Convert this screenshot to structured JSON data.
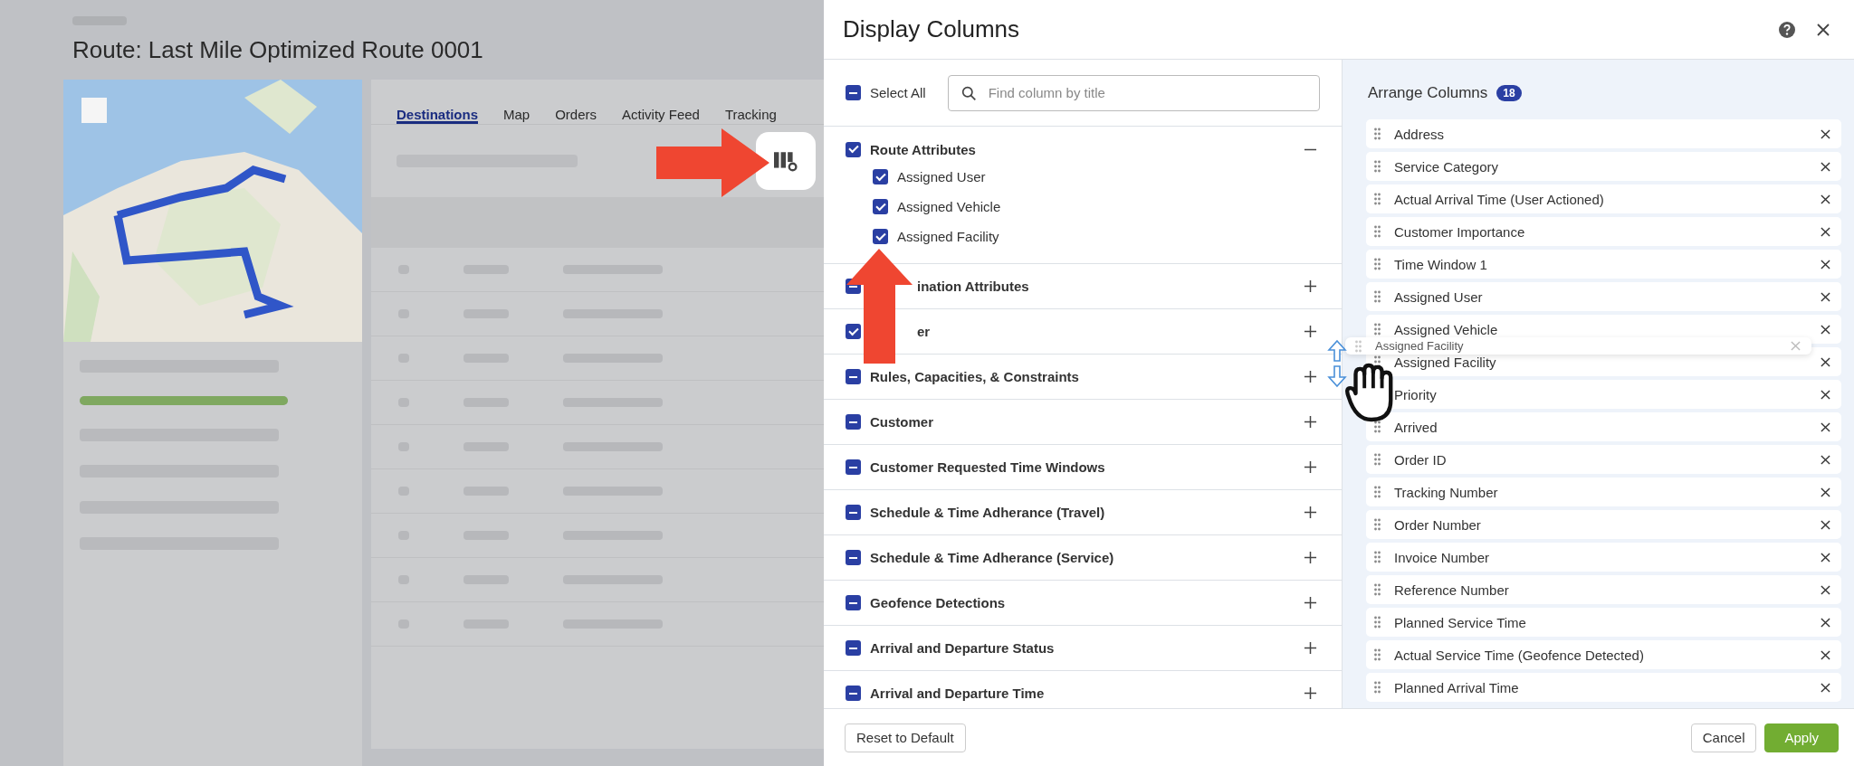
{
  "page": {
    "title": "Route: Last Mile Optimized Route 0001",
    "tabs": [
      {
        "label": "Destinations",
        "selected": true
      },
      {
        "label": "Map",
        "selected": false
      },
      {
        "label": "Orders",
        "selected": false
      },
      {
        "label": "Activity Feed",
        "selected": false
      },
      {
        "label": "Tracking",
        "selected": false
      }
    ],
    "progress": {
      "level": 1
    }
  },
  "dialog": {
    "title": "Display Columns",
    "select_all": {
      "label": "Select All",
      "checked": true,
      "partial": true
    },
    "search": {
      "placeholder": "Find column by title"
    },
    "groups": [
      {
        "label": "Route Attributes",
        "checked": true,
        "partial": false,
        "expanded": true,
        "children": [
          {
            "label": "Assigned User",
            "checked": true
          },
          {
            "label": "Assigned Vehicle",
            "checked": true
          },
          {
            "label": "Assigned Facility",
            "checked": true
          }
        ]
      },
      {
        "label": "ination Attributes",
        "kind": "covered",
        "checked": true,
        "partial": true,
        "expanded": false
      },
      {
        "label": "er",
        "kind": "covered",
        "checked": true,
        "partial": false,
        "expanded": false
      },
      {
        "label": "Rules, Capacities, & Constraints",
        "kind": "plain",
        "checked": true,
        "partial": true,
        "expanded": false
      },
      {
        "label": "Customer",
        "kind": "plain",
        "checked": true,
        "partial": true,
        "expanded": false
      },
      {
        "label": "Customer Requested Time Windows",
        "kind": "plain",
        "checked": true,
        "partial": true,
        "expanded": false
      },
      {
        "label": "Schedule & Time Adherance (Travel)",
        "kind": "plain",
        "checked": true,
        "partial": true,
        "expanded": false
      },
      {
        "label": "Schedule & Time Adherance (Service)",
        "kind": "plain",
        "checked": true,
        "partial": true,
        "expanded": false
      },
      {
        "label": "Geofence Detections",
        "kind": "plain",
        "checked": true,
        "partial": true,
        "expanded": false
      },
      {
        "label": "Arrival and Departure Status",
        "kind": "plain",
        "checked": true,
        "partial": true,
        "expanded": false
      },
      {
        "label": "Arrival and Departure Time",
        "kind": "plain",
        "checked": true,
        "partial": true,
        "expanded": false
      }
    ],
    "arrange": {
      "title": "Arrange Columns",
      "count": "18",
      "items": [
        "Address",
        "Service Category",
        "Actual Arrival Time (User Actioned)",
        "Customer Importance",
        "Time Window 1",
        "Assigned User",
        "Assigned Vehicle",
        "Assigned Facility",
        "Priority",
        "Arrived",
        "Order ID",
        "Tracking Number",
        "Order Number",
        "Invoice Number",
        "Reference Number",
        "Planned Service Time",
        "Actual Service Time (Geofence Detected)",
        "Planned Arrival Time"
      ],
      "dragging": "Assigned Facility"
    },
    "buttons": {
      "reset": "Reset to Default",
      "cancel": "Cancel",
      "apply": "Apply"
    }
  }
}
